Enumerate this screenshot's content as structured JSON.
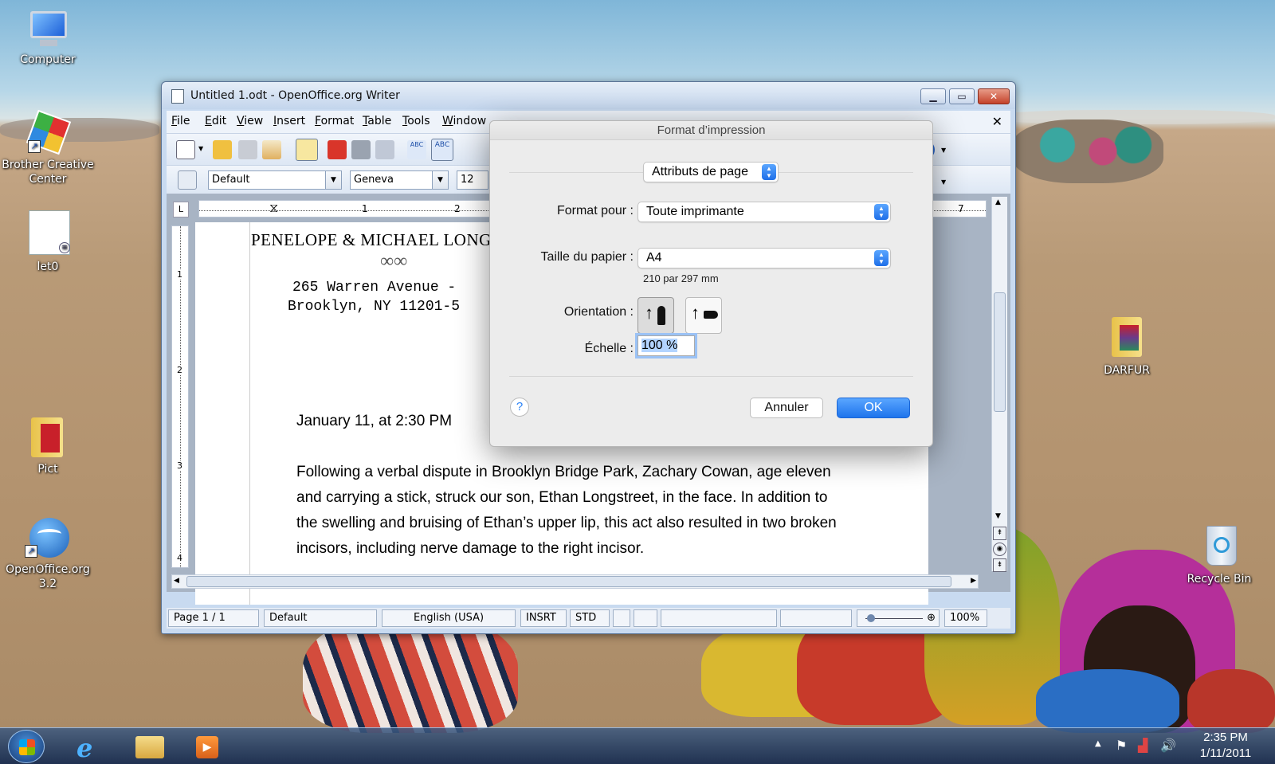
{
  "desktop": {
    "icons": [
      {
        "label": "Computer"
      },
      {
        "label": "Brother Creative Center"
      },
      {
        "label": "let0"
      },
      {
        "label": "Pict"
      },
      {
        "label": "OpenOffice.org 3.2"
      },
      {
        "label": "DARFUR"
      },
      {
        "label": "Recycle Bin"
      }
    ]
  },
  "writer": {
    "title": "Untitled 1.odt - OpenOffice.org Writer",
    "menu": [
      "File",
      "Edit",
      "View",
      "Insert",
      "Format",
      "Table",
      "Tools",
      "Window"
    ],
    "paragraph_style": "Default",
    "font_name": "Geneva",
    "font_size": "12",
    "ruler_h_numbers": [
      "1",
      "2",
      "7"
    ],
    "ruler_v_numbers": [
      "1",
      "2",
      "3",
      "4"
    ],
    "document": {
      "letterhead_name": "PENELOPE & MICHAEL LONG",
      "ornament": "∞∞",
      "address_line1": "265 Warren Avenue -",
      "address_line2": "Brooklyn, NY 11201-5",
      "date_line": "January 11, at 2:30 PM",
      "paragraph_lines": [
        "Following a verbal dispute in Brooklyn Bridge Park, Zachary Cowan, age eleven",
        "and carrying a stick, struck our son, Ethan Longstreet, in the face. In addition to",
        "the swelling and bruising of Ethan’s upper lip, this act also resulted in two broken",
        "incisors, including nerve damage to the right incisor."
      ]
    },
    "status": {
      "page": "Page 1 / 1",
      "style": "Default",
      "language": "English (USA)",
      "insert_mode": "INSRT",
      "selection_mode": "STD",
      "zoom": "100%"
    }
  },
  "dialog": {
    "title": "Format d’impression",
    "settings_popup": "Attributs de page",
    "format_for_label": "Format pour :",
    "format_for_value": "Toute imprimante",
    "paper_size_label": "Taille du papier :",
    "paper_size_value": "A4",
    "paper_size_detail": "210 par 297 mm",
    "orientation_label": "Orientation :",
    "orientation_selected": "portrait",
    "scale_label": "Échelle :",
    "scale_value": "100 %",
    "help": "?",
    "cancel": "Annuler",
    "ok": "OK"
  },
  "taskbar": {
    "time": "2:35 PM",
    "date": "1/11/2011"
  },
  "colors": {
    "accent": "#2a82f6",
    "titlebar": "#c3d5ec",
    "close": "#c4422a"
  }
}
